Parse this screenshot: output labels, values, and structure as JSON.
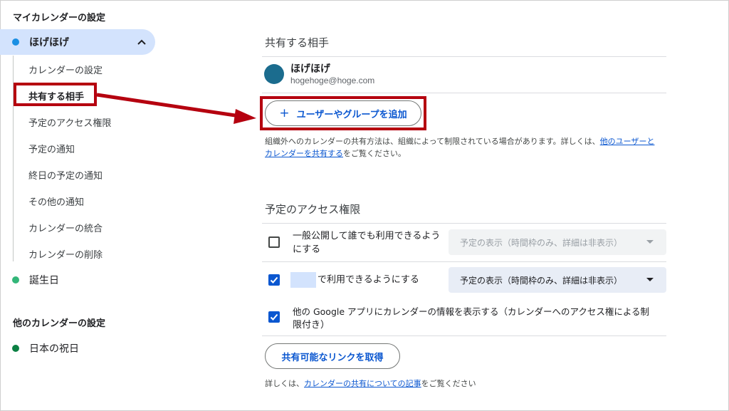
{
  "sidebar": {
    "my_calendars_title": "マイカレンダーの設定",
    "active_calendar": {
      "name": "ほげほげ",
      "color": "#1a8fe3"
    },
    "sub_items": [
      "カレンダーの設定",
      "共有する相手",
      "予定のアクセス権限",
      "予定の通知",
      "終日の予定の通知",
      "その他の通知",
      "カレンダーの統合",
      "カレンダーの削除"
    ],
    "birthday": {
      "name": "誕生日",
      "color": "#33b679"
    },
    "other_calendars_title": "他のカレンダーの設定",
    "holiday": {
      "name": "日本の祝日",
      "color": "#0b8043"
    }
  },
  "share": {
    "title": "共有する相手",
    "member": {
      "name": "ほげほげ",
      "email": "hogehoge@hoge.com"
    },
    "add_button": "ユーザーやグループを追加",
    "note_prefix": "組織外へのカレンダーの共有方法は、組織によって制限されている場合があります。詳しくは、",
    "note_link_1": "他のユーザーと",
    "note_link_2": "カレンダーを共有する",
    "note_suffix": "をご覧ください。"
  },
  "access": {
    "title": "予定のアクセス権限",
    "public_line1": "一般公開して誰でも利用できるよう",
    "public_line2": "にする",
    "public_checked": false,
    "public_select": "予定の表示（時間枠のみ、詳細は非表示）",
    "org_label": "で利用できるようにする",
    "org_checked": true,
    "org_select": "予定の表示（時間枠のみ、詳細は非表示）",
    "apps_line1": "他の Google アプリにカレンダーの情報を表示する（カレンダーへのアクセス権による制",
    "apps_line2": "限付き）",
    "apps_checked": true,
    "link_button": "共有可能なリンクを取得",
    "footer_prefix": "詳しくは、",
    "footer_link": "カレンダーの共有についての記事",
    "footer_suffix": "をご覧ください"
  },
  "colors": {
    "accent": "#0b57d0",
    "annotation_red": "#b5000f",
    "active_bg": "#d3e3fd"
  },
  "icons": [
    "chevron-up-icon",
    "plus-icon",
    "checkbox-icon",
    "dropdown-caret-icon",
    "arrow-annotation-icon"
  ]
}
